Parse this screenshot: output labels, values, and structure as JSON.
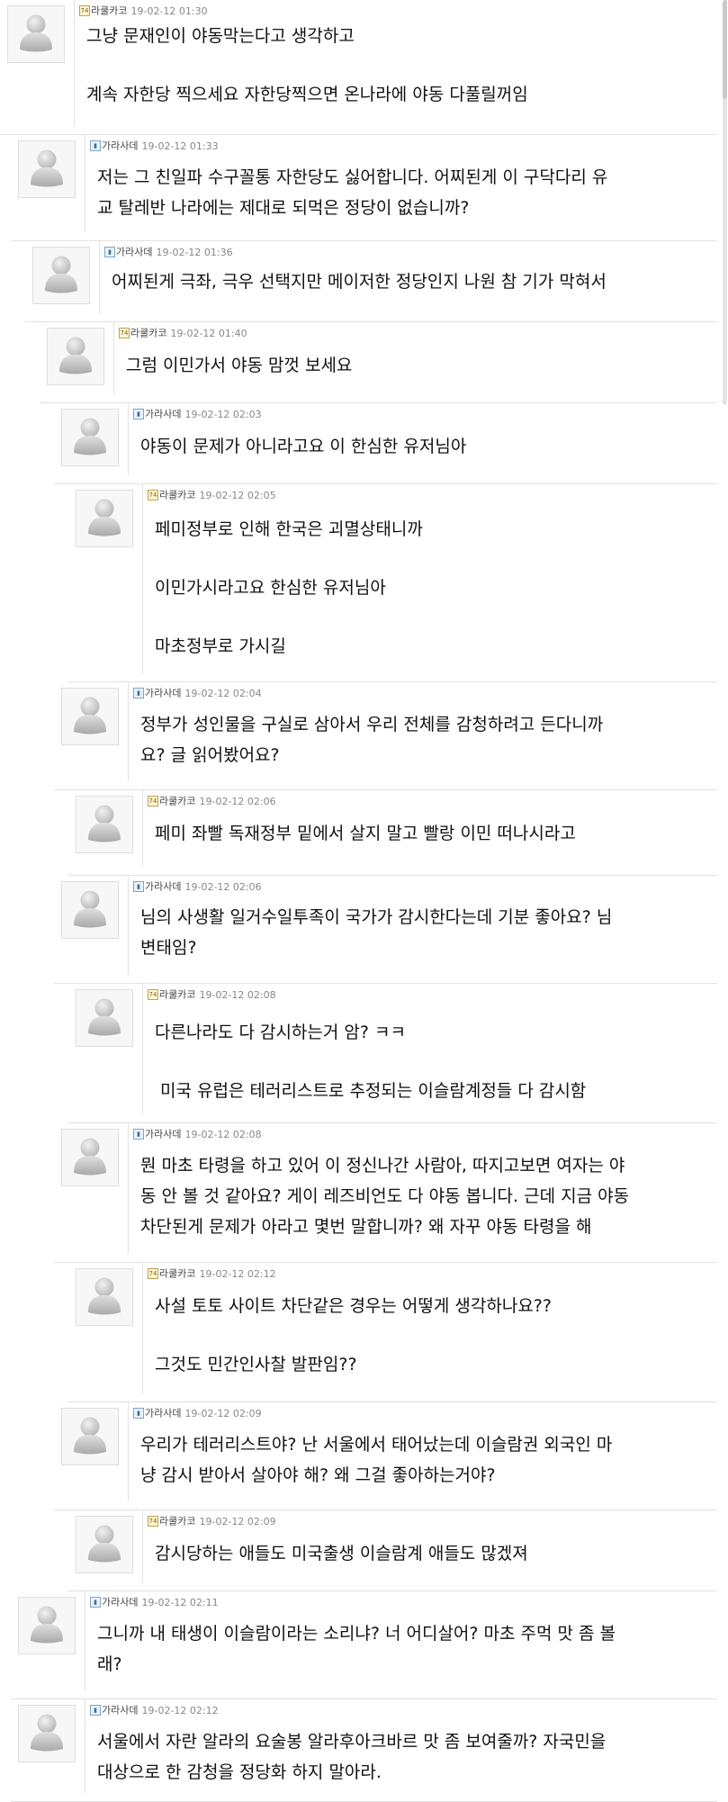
{
  "comments": [
    {
      "author": "라쿨카코",
      "badge": "gold",
      "date": "19-02-12 01:30",
      "lines": [
        "그냥 문재인이 야동막는다고 생각하고",
        "계속 자한당 찍으세요 자한당찍으면 온나라에 야동 다풀릴꺼임"
      ]
    },
    {
      "author": "가라사데",
      "badge": "blue",
      "date": "19-02-12 01:33",
      "lines": [
        "저는 그 친일파 수구꼴통 자한당도 싫어합니다. 어찌된게 이 구닥다리 유",
        "교 탈레반 나라에는 제대로 되먹은 정당이 없습니까?"
      ]
    },
    {
      "author": "가라사데",
      "badge": "blue",
      "date": "19-02-12 01:36",
      "lines": [
        "어찌된게 극좌, 극우 선택지만 메이저한 정당인지 나원 참 기가 막혀서"
      ]
    },
    {
      "author": "라쿨카코",
      "badge": "gold",
      "date": "19-02-12 01:40",
      "lines": [
        "그럼 이민가서 야동 맘껏 보세요"
      ]
    },
    {
      "author": "가라사데",
      "badge": "blue",
      "date": "19-02-12 02:03",
      "lines": [
        "야동이 문제가 아니라고요 이 한심한 유저님아"
      ]
    },
    {
      "author": "라쿨카코",
      "badge": "gold",
      "date": "19-02-12 02:05",
      "lines": [
        "페미정부로 인해 한국은 괴멸상태니까",
        "이민가시라고요 한심한 유저님아",
        "마초정부로 가시길"
      ]
    },
    {
      "author": "가라사데",
      "badge": "blue",
      "date": "19-02-12 02:04",
      "lines": [
        "정부가 성인물을 구실로 삼아서 우리 전체를 감청하려고 든다니까",
        "요? 글 읽어봤어요?"
      ]
    },
    {
      "author": "라쿨카코",
      "badge": "gold",
      "date": "19-02-12 02:06",
      "lines": [
        "페미 좌빨 독재정부 밑에서 살지 말고 빨랑 이민 떠나시라고"
      ]
    },
    {
      "author": "가라사데",
      "badge": "blue",
      "date": "19-02-12 02:06",
      "lines": [
        "님의 사생활 일거수일투족이 국가가 감시한다는데 기분 좋아요? 님",
        "변태임?"
      ]
    },
    {
      "author": "라쿨카코",
      "badge": "gold",
      "date": "19-02-12 02:08",
      "lines": [
        "다른나라도 다 감시하는거 암? ㅋㅋ",
        " 미국 유럽은 테러리스트로 추정되는 이슬람계정들 다 감시함"
      ]
    },
    {
      "author": "가라사데",
      "badge": "blue",
      "date": "19-02-12 02:08",
      "lines": [
        "뭔 마초 타령을 하고 있어 이 정신나간 사람아, 따지고보면 여자는 야",
        "동 안 볼 것 같아요? 게이 레즈비언도 다 야동 봅니다. 근데 지금 야동",
        "차단된게 문제가 아라고 몇번 말합니까? 왜 자꾸 야동 타령을 해"
      ]
    },
    {
      "author": "라쿨카코",
      "badge": "gold",
      "date": "19-02-12 02:12",
      "lines": [
        "사설 토토 사이트 차단같은 경우는 어떻게 생각하나요??",
        "그것도 민간인사찰 발판임??"
      ]
    },
    {
      "author": "가라사데",
      "badge": "blue",
      "date": "19-02-12 02:09",
      "lines": [
        "우리가 테러리스트야? 난 서울에서 태어났는데 이슬람권 외국인 마",
        "냥 감시 받아서 살아야 해? 왜 그걸 좋아하는거야?"
      ]
    },
    {
      "author": "라쿨카코",
      "badge": "gold",
      "date": "19-02-12 02:09",
      "lines": [
        "감시당하는 애들도 미국출생 이슬람계 애들도 많겠져"
      ]
    },
    {
      "author": "가라사데",
      "badge": "blue",
      "date": "19-02-12 02:11",
      "lines": [
        "그니까 내 태생이 이슬람이라는 소리냐? 너 어디살어? 마초 주먹 맛 좀 볼",
        "래?"
      ]
    },
    {
      "author": "가라사데",
      "badge": "blue",
      "date": "19-02-12 02:12",
      "lines": [
        "서울에서 자란 알라의 요술봉 알라후아크바르 맛 좀 보여줄까? 자국민을",
        "대상으로 한 감청을 정당화 하지 말아라."
      ]
    }
  ]
}
